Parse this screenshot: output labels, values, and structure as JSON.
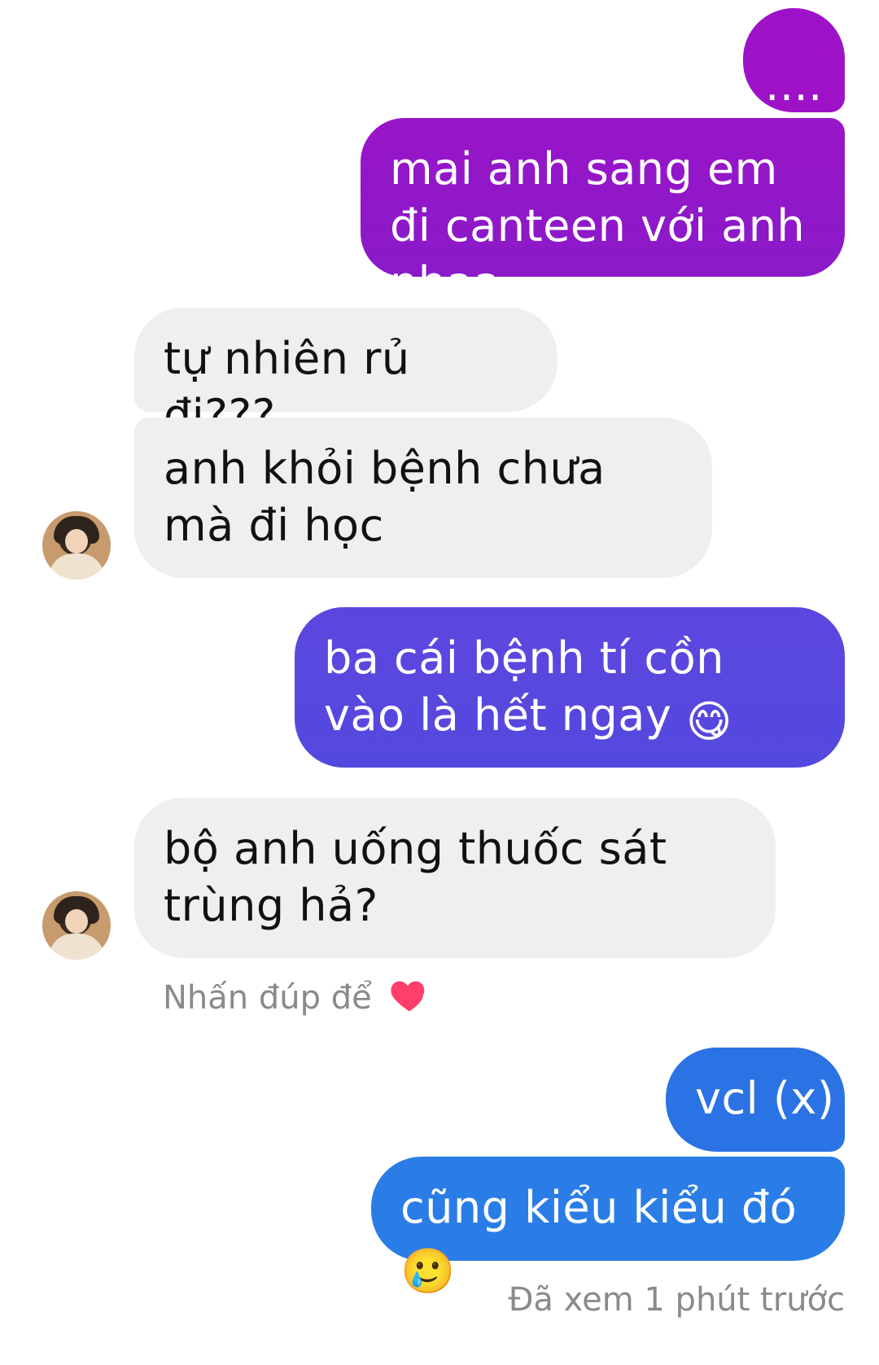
{
  "messages": [
    {
      "side": "sent",
      "text": "...."
    },
    {
      "side": "sent",
      "text": "mai anh sang em đi canteen với anh nhaa"
    },
    {
      "side": "received",
      "text": "tự nhiên rủ đi???"
    },
    {
      "side": "received",
      "text": "anh khỏi bệnh chưa mà đi học"
    },
    {
      "side": "sent",
      "text": "ba cái bệnh tí cồn vào là hết ngay"
    },
    {
      "side": "received",
      "text": "bộ anh uống thuốc sát trùng hả?"
    },
    {
      "side": "sent",
      "text": "vcl (x)"
    },
    {
      "side": "sent",
      "text": "cũng kiểu kiểu đó"
    }
  ],
  "emojis": {
    "m4": "😋",
    "m7": "🥲"
  },
  "hints": {
    "double_tap_text": "Nhấn đúp để",
    "double_tap_icon": "heart-icon"
  },
  "status": {
    "seen_text": "Đã xem 1 phút trước"
  },
  "colors": {
    "sent_gradient_top": "#9d12c7",
    "sent_gradient_mid": "#5a46df",
    "sent_gradient_bottom": "#2a7de6",
    "received_bg": "#efefef",
    "heart": "#ff3e6c"
  }
}
